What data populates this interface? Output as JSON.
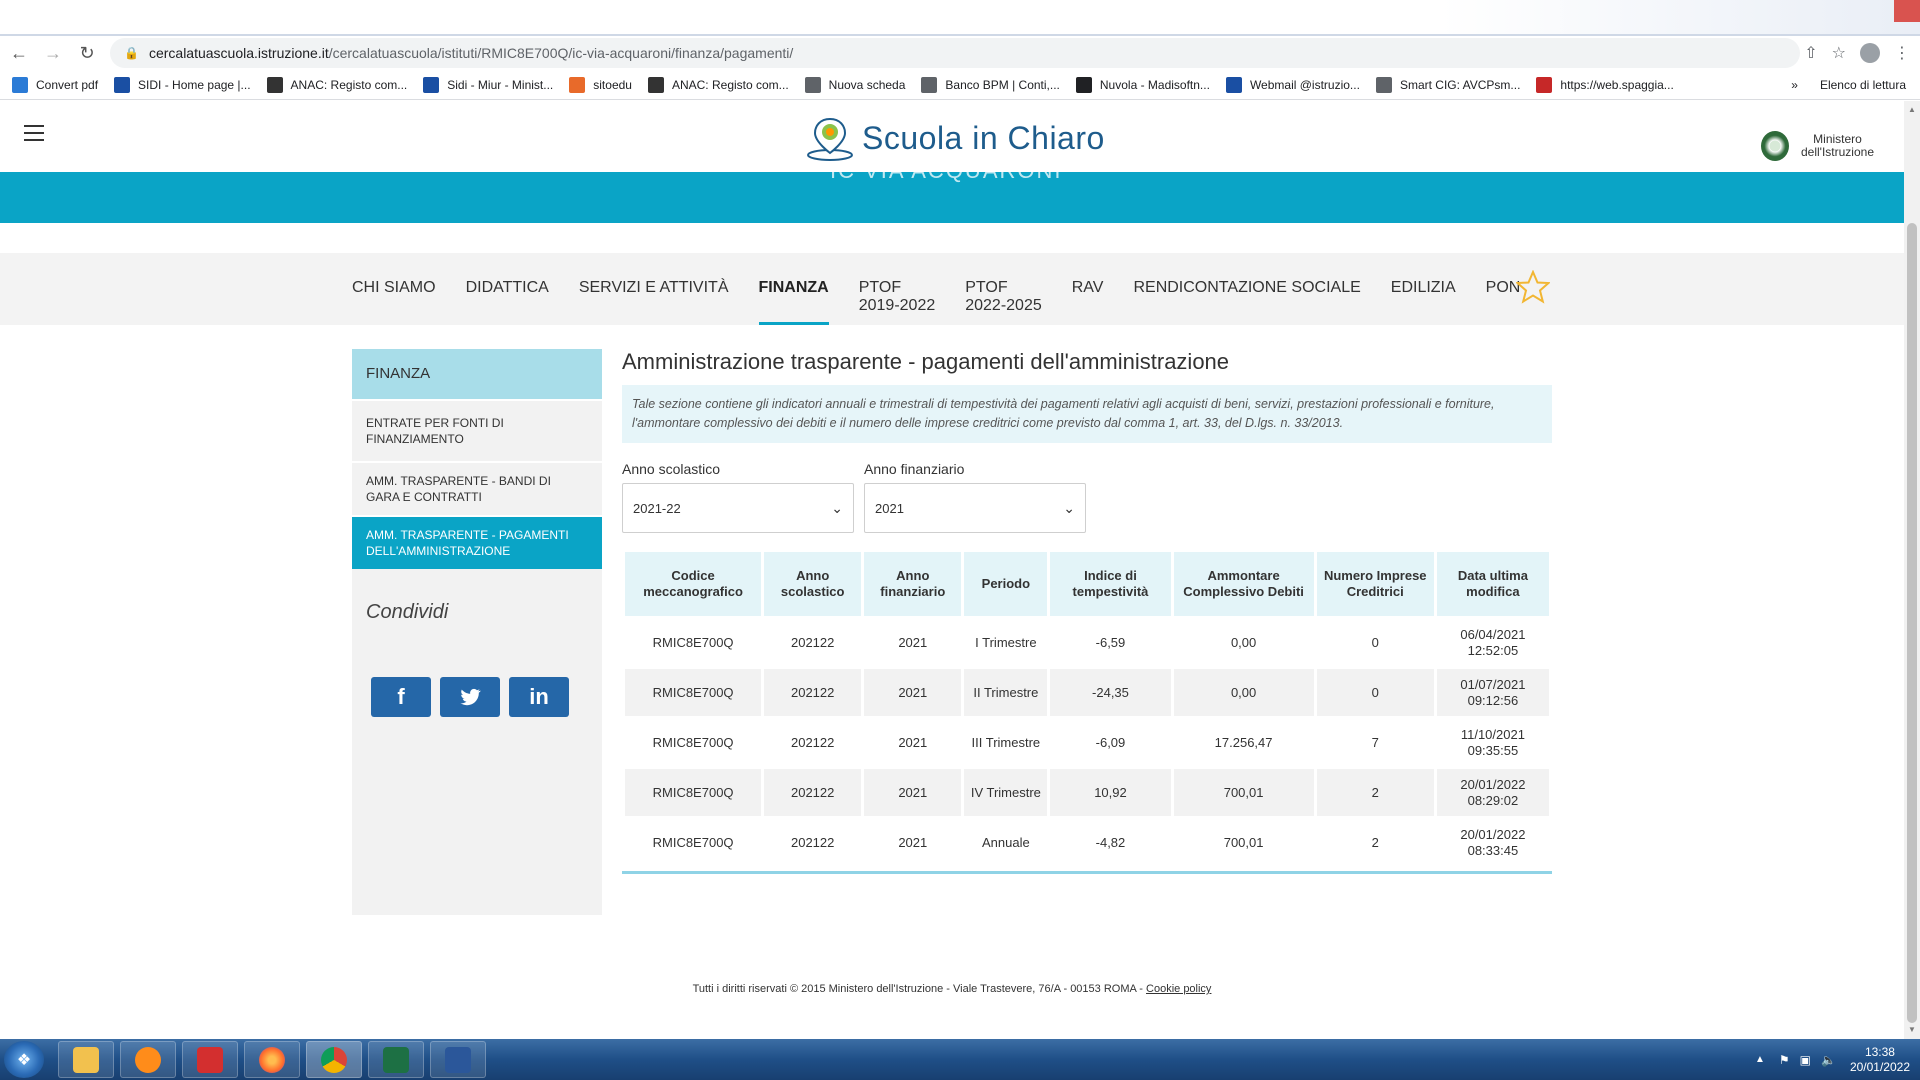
{
  "browser": {
    "url_host": "cercalatuascuola.istruzione.it",
    "url_path": "/cercalatuascuola/istituti/RMIC8E700Q/ic-via-acquaroni/finanza/pagamenti/",
    "bookmarks": [
      {
        "label": "Convert pdf",
        "color": "#2b7bd6"
      },
      {
        "label": "SIDI - Home page |...",
        "color": "#1a4fa3"
      },
      {
        "label": "ANAC: Registo com...",
        "color": "#333333"
      },
      {
        "label": "Sidi - Miur - Minist...",
        "color": "#1a4fa3"
      },
      {
        "label": "sitoedu",
        "color": "#e86a2a"
      },
      {
        "label": "ANAC: Registo com...",
        "color": "#333333"
      },
      {
        "label": "Nuova scheda",
        "color": "#5f6368"
      },
      {
        "label": "Banco BPM | Conti,...",
        "color": "#5f6368"
      },
      {
        "label": "Nuvola - Madisoftn...",
        "color": "#202124"
      },
      {
        "label": "Webmail @istruzio...",
        "color": "#1a4fa3"
      },
      {
        "label": "Smart CIG: AVCPsm...",
        "color": "#5f6368"
      },
      {
        "label": "https://web.spaggia...",
        "color": "#c62828"
      }
    ],
    "more_bookmarks": "»",
    "reading_list": "Elenco di lettura"
  },
  "header": {
    "logo_text": "Scuola in Chiaro",
    "ministero_line1": "Ministero",
    "ministero_line2": "dell'Istruzione",
    "hero_ghost": "IC VIA ACQUARONI"
  },
  "menu": {
    "items": [
      {
        "label": "CHI SIAMO"
      },
      {
        "label": "DIDATTICA"
      },
      {
        "label": "SERVIZI E ATTIVITÀ"
      },
      {
        "label": "FINANZA",
        "active": true
      },
      {
        "label": "PTOF",
        "label2": "2019-2022"
      },
      {
        "label": "PTOF",
        "label2": "2022-2025"
      },
      {
        "label": "RAV"
      },
      {
        "label": "RENDICONTAZIONE SOCIALE"
      },
      {
        "label": "EDILIZIA"
      },
      {
        "label": "PON"
      }
    ]
  },
  "sidebar": {
    "title": "FINANZA",
    "items": [
      {
        "label": "ENTRATE PER FONTI DI FINANZIAMENTO"
      },
      {
        "label": "AMM. TRASPARENTE - BANDI DI GARA E CONTRATTI"
      },
      {
        "label": "AMM. TRASPARENTE - PAGAMENTI DELL'AMMINISTRAZIONE"
      }
    ],
    "share_title": "Condividi",
    "share": {
      "facebook": "f",
      "twitter": "t",
      "linkedin": "in"
    }
  },
  "main": {
    "title": "Amministrazione trasparente - pagamenti dell'amministrazione",
    "info": "Tale sezione contiene gli indicatori annuali e trimestrali di tempestività dei pagamenti relativi agli acquisti di beni, servizi, prestazioni professionali e forniture, l'ammontare complessivo dei debiti e il numero delle imprese creditrici come previsto dal comma 1, art. 33, del D.lgs. n. 33/2013.",
    "filters": {
      "anno_scolastico_label": "Anno scolastico",
      "anno_scolastico_value": "2021-22",
      "anno_finanziario_label": "Anno finanziario",
      "anno_finanziario_value": "2021"
    },
    "table": {
      "headers": [
        "Codice meccanografico",
        "Anno scolastico",
        "Anno finanziario",
        "Periodo",
        "Indice di tempestività",
        "Ammontare Complessivo Debiti",
        "Numero Imprese Creditrici",
        "Data ultima modifica"
      ],
      "rows": [
        [
          "RMIC8E700Q",
          "202122",
          "2021",
          "I Trimestre",
          "-6,59",
          "0,00",
          "0",
          "06/04/2021 12:52:05"
        ],
        [
          "RMIC8E700Q",
          "202122",
          "2021",
          "II Trimestre",
          "-24,35",
          "0,00",
          "0",
          "01/07/2021 09:12:56"
        ],
        [
          "RMIC8E700Q",
          "202122",
          "2021",
          "III Trimestre",
          "-6,09",
          "17.256,47",
          "7",
          "11/10/2021 09:35:55"
        ],
        [
          "RMIC8E700Q",
          "202122",
          "2021",
          "IV Trimestre",
          "10,92",
          "700,01",
          "2",
          "20/01/2022 08:29:02"
        ],
        [
          "RMIC8E700Q",
          "202122",
          "2021",
          "Annuale",
          "-4,82",
          "700,01",
          "2",
          "20/01/2022 08:33:45"
        ]
      ]
    }
  },
  "footer": {
    "text": "Tutti i diritti riservati © 2015 Ministero dell'Istruzione - Viale Trastevere, 76/A - 00153 ROMA - ",
    "link": "Cookie policy"
  },
  "taskbar": {
    "time": "13:38",
    "date": "20/01/2022"
  }
}
